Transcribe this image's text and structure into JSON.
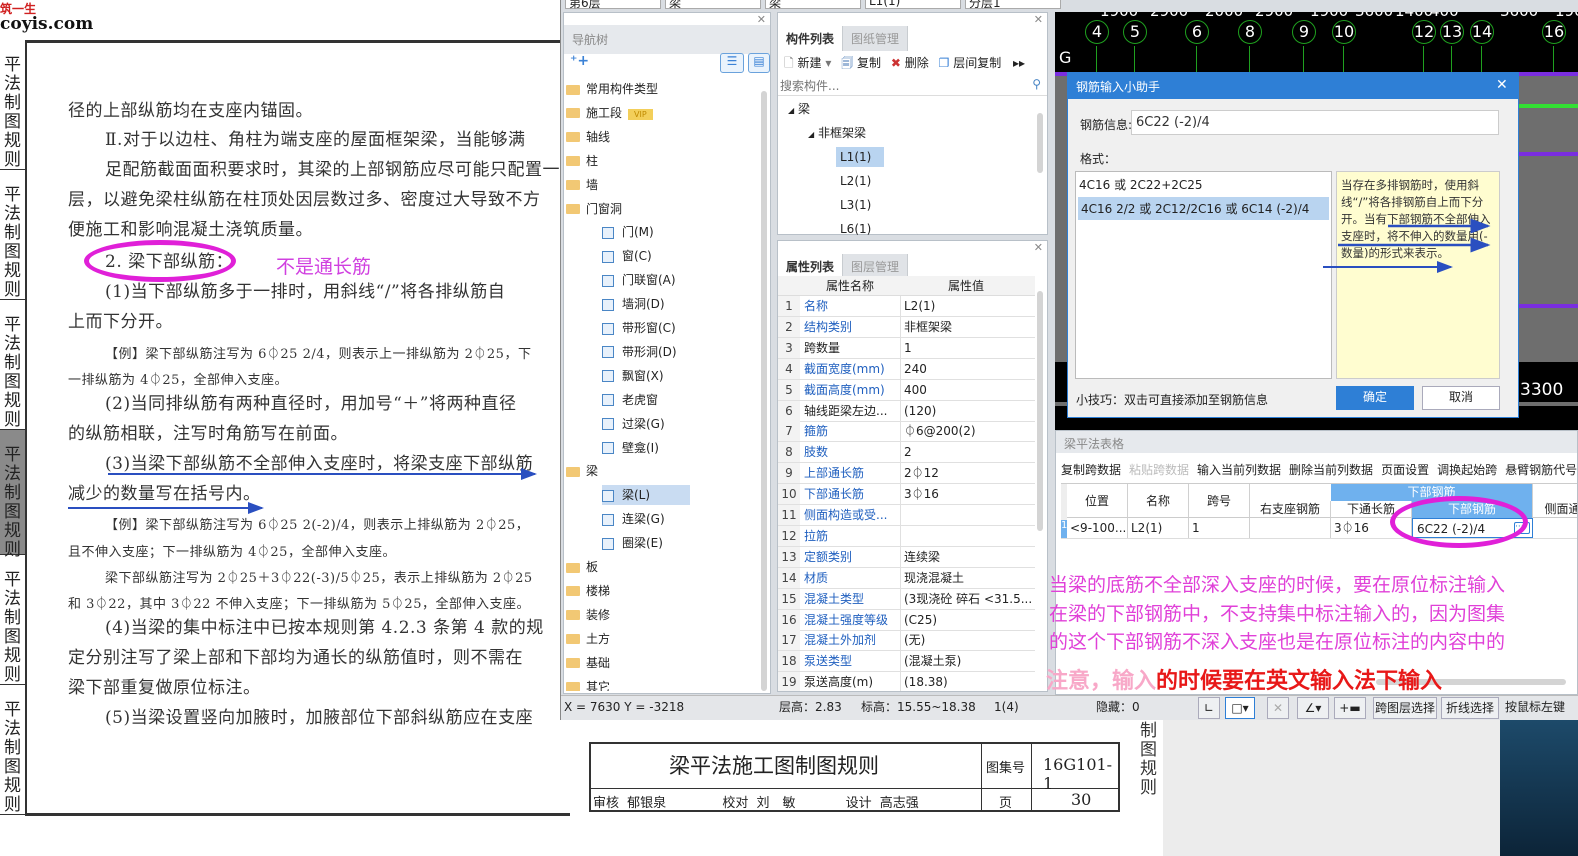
{
  "watermark": {
    "brand": "筑一生",
    "site": "coyis.com"
  },
  "document": {
    "side_tab_label": "平法制图规则",
    "lines": [
      "径的上部纵筋均在支座内锚固。",
      "Ⅱ.对于以边柱、角柱为端支座的屋面框架梁，当能够满",
      "足配筋截面面积要求时，其梁的上部钢筋应尽可能只配置一",
      "层，以避免梁柱纵筋在柱顶处因层数过多、密度过大导致不方",
      "便施工和影响混凝土浇筑质量。",
      "2. 梁下部纵筋：",
      "(1)当下部纵筋多于一排时，用斜线“/”将各排纵筋自",
      "上而下分开。",
      "【例】梁下部纵筋注写为 6⏀25 2/4，则表示上一排纵筋为 2⏀25，下",
      "一排纵筋为 4⏀25，全部伸入支座。",
      "(2)当同排纵筋有两种直径时，用加号“＋”将两种直径",
      "的纵筋相联，注写时角筋写在前面。",
      "(3)当梁下部纵筋不全部伸入支座时，将梁支座下部纵筋",
      "减少的数量写在括号内。",
      "【例】梁下部纵筋注写为 6⏀25 2(-2)/4，则表示上排纵筋为 2⏀25，",
      "且不伸入支座；下一排纵筋为 4⏀25，全部伸入支座。",
      "梁下部纵筋注写为 2⏀25＋3⏀22(-3)/5⏀25，表示上排纵筋为 2⏀25",
      "和 3⏀22，其中 3⏀22 不伸入支座；下一排纵筋为 5⏀25，全部伸入支座。",
      "(4)当梁的集中标注中已按本规则第 4.2.3 条第 4 款的规",
      "定分别注写了梁上部和下部均为通长的纵筋值时，则不需在",
      "梁下部重复做原位标注。",
      "(5)当梁设置竖向加腋时，加腋部位下部斜纵筋应在支座"
    ],
    "annotation": "不是通长筋",
    "title_block": {
      "title": "梁平法施工图制图规则",
      "atlas_label": "图集号",
      "atlas_no": "16G101-1",
      "review": "审核",
      "reviewer": "郁银泉",
      "check": "校对",
      "checker": "刘　敏",
      "design": "设计",
      "designer": "高志强",
      "page_label": "页",
      "page_no": "30"
    },
    "side_label_right": "制图规则"
  },
  "app": {
    "top_selectors": [
      "第6层",
      "梁",
      "梁",
      "L1(1)",
      "分层1"
    ],
    "nav": {
      "title": "导航树",
      "items": [
        {
          "label": "常用构件类型",
          "level": 0
        },
        {
          "label": "施工段",
          "level": 0,
          "badge": "VIP"
        },
        {
          "label": "轴线",
          "level": 0
        },
        {
          "label": "柱",
          "level": 0
        },
        {
          "label": "墙",
          "level": 0
        },
        {
          "label": "门窗洞",
          "level": 0,
          "open": true
        },
        {
          "label": "门(M)",
          "level": 1
        },
        {
          "label": "窗(C)",
          "level": 1
        },
        {
          "label": "门联窗(A)",
          "level": 1
        },
        {
          "label": "墙洞(D)",
          "level": 1
        },
        {
          "label": "带形窗(C)",
          "level": 1
        },
        {
          "label": "带形洞(D)",
          "level": 1
        },
        {
          "label": "飘窗(X)",
          "level": 1
        },
        {
          "label": "老虎窗",
          "level": 1
        },
        {
          "label": "过梁(G)",
          "level": 1
        },
        {
          "label": "壁龛(I)",
          "level": 1
        },
        {
          "label": "梁",
          "level": 0,
          "open": true
        },
        {
          "label": "梁(L)",
          "level": 1,
          "selected": true
        },
        {
          "label": "连梁(G)",
          "level": 1
        },
        {
          "label": "圈梁(E)",
          "level": 1
        },
        {
          "label": "板",
          "level": 0
        },
        {
          "label": "楼梯",
          "level": 0
        },
        {
          "label": "装修",
          "level": 0
        },
        {
          "label": "土方",
          "level": 0
        },
        {
          "label": "基础",
          "level": 0
        },
        {
          "label": "其它",
          "level": 0
        }
      ]
    },
    "component_list": {
      "tabs": [
        "构件列表",
        "图纸管理"
      ],
      "toolbar": [
        "新建",
        "复制",
        "删除",
        "层间复制"
      ],
      "search_placeholder": "搜索构件...",
      "tree": {
        "root": "梁",
        "group": "非框架梁",
        "items": [
          "L1(1)",
          "L2(1)",
          "L3(1)",
          "L6(1)"
        ],
        "selected": "L1(1)"
      }
    },
    "properties": {
      "tabs": [
        "属性列表",
        "图层管理"
      ],
      "headers": [
        "属性名称",
        "属性值"
      ],
      "rows": [
        {
          "n": "1",
          "k": "名称",
          "v": "L2(1)",
          "blue": true
        },
        {
          "n": "2",
          "k": "结构类别",
          "v": "非框架梁",
          "blue": true
        },
        {
          "n": "3",
          "k": "跨数量",
          "v": "1",
          "blue": false
        },
        {
          "n": "4",
          "k": "截面宽度(mm)",
          "v": "240",
          "blue": true
        },
        {
          "n": "5",
          "k": "截面高度(mm)",
          "v": "400",
          "blue": true
        },
        {
          "n": "6",
          "k": "轴线距梁左边...",
          "v": "(120)",
          "blue": false
        },
        {
          "n": "7",
          "k": "箍筋",
          "v": "⏀6@200(2)",
          "blue": true
        },
        {
          "n": "8",
          "k": "肢数",
          "v": "2",
          "blue": true
        },
        {
          "n": "9",
          "k": "上部通长筋",
          "v": "2⏀12",
          "blue": true
        },
        {
          "n": "10",
          "k": "下部通长筋",
          "v": "3⏀16",
          "blue": true
        },
        {
          "n": "11",
          "k": "侧面构造或受...",
          "v": "",
          "blue": true
        },
        {
          "n": "12",
          "k": "拉筋",
          "v": "",
          "blue": true
        },
        {
          "n": "13",
          "k": "定额类别",
          "v": "连续梁",
          "blue": true
        },
        {
          "n": "14",
          "k": "材质",
          "v": "现浇混凝土",
          "blue": true
        },
        {
          "n": "15",
          "k": "混凝土类型",
          "v": "(3现浇砼 碎石 <31.5...",
          "blue": true
        },
        {
          "n": "16",
          "k": "混凝土强度等级",
          "v": "(C25)",
          "blue": true
        },
        {
          "n": "17",
          "k": "混凝土外加剂",
          "v": "(无)",
          "blue": true
        },
        {
          "n": "18",
          "k": "泵送类型",
          "v": "(混凝土泵)",
          "blue": true
        },
        {
          "n": "19",
          "k": "泵送高度(m)",
          "v": "(18.38)",
          "blue": false
        }
      ]
    },
    "cad": {
      "axis_dims": [
        "1900",
        "2900",
        "2000",
        "2900",
        "1900",
        "3600",
        "1400",
        "400",
        "3600",
        "1900"
      ],
      "axis_numbers": [
        "4",
        "5",
        "6",
        "8",
        "9",
        "10",
        "12",
        "13",
        "14",
        "16"
      ],
      "row_label": "G",
      "dim_bottom": "3300"
    },
    "dialog": {
      "title": "钢筋输入小助手",
      "info_label": "钢筋信息:",
      "info_value": "6C22 (-2)/4",
      "format_label": "格式：",
      "formats": [
        "4C16 或 2C22+2C25",
        "4C16 2/2 或 2C12/2C16 或 6C14 (-2)/4"
      ],
      "selected_format": 1,
      "hint": "当存在多排钢筋时，使用斜线“/”将各排钢筋自上而下分开。当有下部钢筋不全部伸入支座时，将不伸入的数量用(-数量)的形式来表示。",
      "tip": "小技巧：双击可直接添加至钢筋信息",
      "ok": "确定",
      "cancel": "取消"
    },
    "beam_table": {
      "title": "梁平法表格",
      "toolbar": [
        "复制跨数据",
        "粘贴跨数据",
        "输入当前列数据",
        "删除当前列数据",
        "页面设置",
        "调换起始跨",
        "悬臂钢筋代号"
      ],
      "headers": {
        "pos": "位置",
        "name": "名称",
        "span": "跨号",
        "right_support": "右支座钢筋",
        "group": "下部钢筋",
        "bottom_through": "下通长筋",
        "bottom_bar": "下部钢筋",
        "side": "侧面通"
      },
      "row": {
        "num": "1",
        "pos": "<9-100...",
        "name": "L2(1)",
        "span": "1",
        "right_support": "",
        "bottom_through": "3⏀16",
        "bottom_bar": "6C22 (-2)/4"
      }
    },
    "notes": [
      "当梁的底筋不全部深入支座的时候，要在原位标注输入",
      "在梁的下部钢筋中，不支持集中标注输入的，因为图集",
      "的这个下部钢筋不深入支座也是在原位标注的内容中的"
    ],
    "warning": {
      "faded": "注意，输入",
      "bold": "的时候要在英文输入法下输入"
    },
    "status": {
      "coords": "X = 7630 Y = -3218",
      "floor_height": "层高：2.83",
      "elevation": "标高：15.55~18.38",
      "count": "1(4)",
      "hidden": "隐藏：0",
      "buttons": [
        "跨图层选择",
        "折线选择",
        "按鼠标左键"
      ]
    }
  },
  "colors": {
    "accent": "#2e7fd6",
    "highlight": "#e020d8",
    "arrow": "#2a4fc0",
    "hint_bg": "#fffdd0"
  }
}
